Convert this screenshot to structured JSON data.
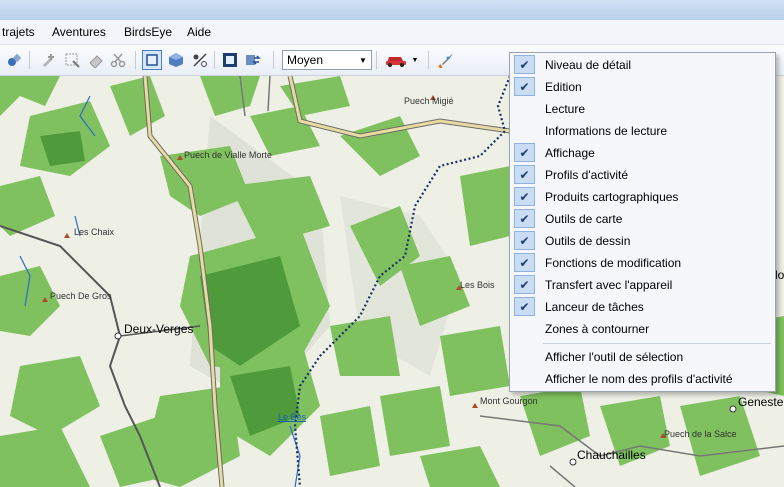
{
  "menu": [
    "trajets",
    "Aventures",
    "BirdsEye",
    "Aide"
  ],
  "toolbar": {
    "detail_level": "Moyen",
    "icons": [
      "connect-icon",
      "pencil-add-icon",
      "select-area-icon",
      "eraser-icon",
      "scissors-icon",
      "2d-view-icon",
      "3d-view-icon",
      "shading-icon",
      "fit-map-icon",
      "transfer-icon",
      "car-profile-icon",
      "rocket-icon"
    ]
  },
  "context_menu": {
    "items": [
      {
        "label": "Niveau de détail",
        "checked": true
      },
      {
        "label": "Edition",
        "checked": true
      },
      {
        "label": "Lecture",
        "checked": false
      },
      {
        "label": "Informations de lecture",
        "checked": false
      },
      {
        "label": "Affichage",
        "checked": true
      },
      {
        "label": "Profils d'activité",
        "checked": true
      },
      {
        "label": "Produits cartographiques",
        "checked": true
      },
      {
        "label": "Outils de carte",
        "checked": true
      },
      {
        "label": "Outils de dessin",
        "checked": true
      },
      {
        "label": "Fonctions de modification",
        "checked": true
      },
      {
        "label": "Transfert avec l'appareil",
        "checked": true
      },
      {
        "label": "Lanceur de tâches",
        "checked": true
      },
      {
        "label": "Zones à contourner",
        "checked": false
      }
    ],
    "footer": [
      {
        "label": "Afficher l'outil de sélection"
      },
      {
        "label": "Afficher le nom des profils d'activité"
      }
    ]
  },
  "map": {
    "places": [
      {
        "name": "Puech Migié",
        "type": "peak"
      },
      {
        "name": "Puech de Vialle Morte",
        "type": "peak"
      },
      {
        "name": "Les Chaix",
        "type": "peak"
      },
      {
        "name": "Puech De Gros",
        "type": "peak"
      },
      {
        "name": "Deux-Verges",
        "type": "town"
      },
      {
        "name": "Les Bois",
        "type": "peak"
      },
      {
        "name": "Mont Gourgon",
        "type": "peak"
      },
      {
        "name": "Le Bès",
        "type": "water"
      },
      {
        "name": "Chauchailles",
        "type": "town"
      },
      {
        "name": "Puech de la Salce",
        "type": "peak"
      },
      {
        "name": "Geneste",
        "type": "town"
      },
      {
        "name": "lo",
        "type": "town"
      }
    ]
  },
  "colors": {
    "forest": "#7fc15e",
    "forest_dark": "#4f9b3c",
    "road": "#e8dba0",
    "road_edge": "#6b6b6b",
    "water": "#2a6ec6",
    "check_bg": "#c8dcf4"
  }
}
